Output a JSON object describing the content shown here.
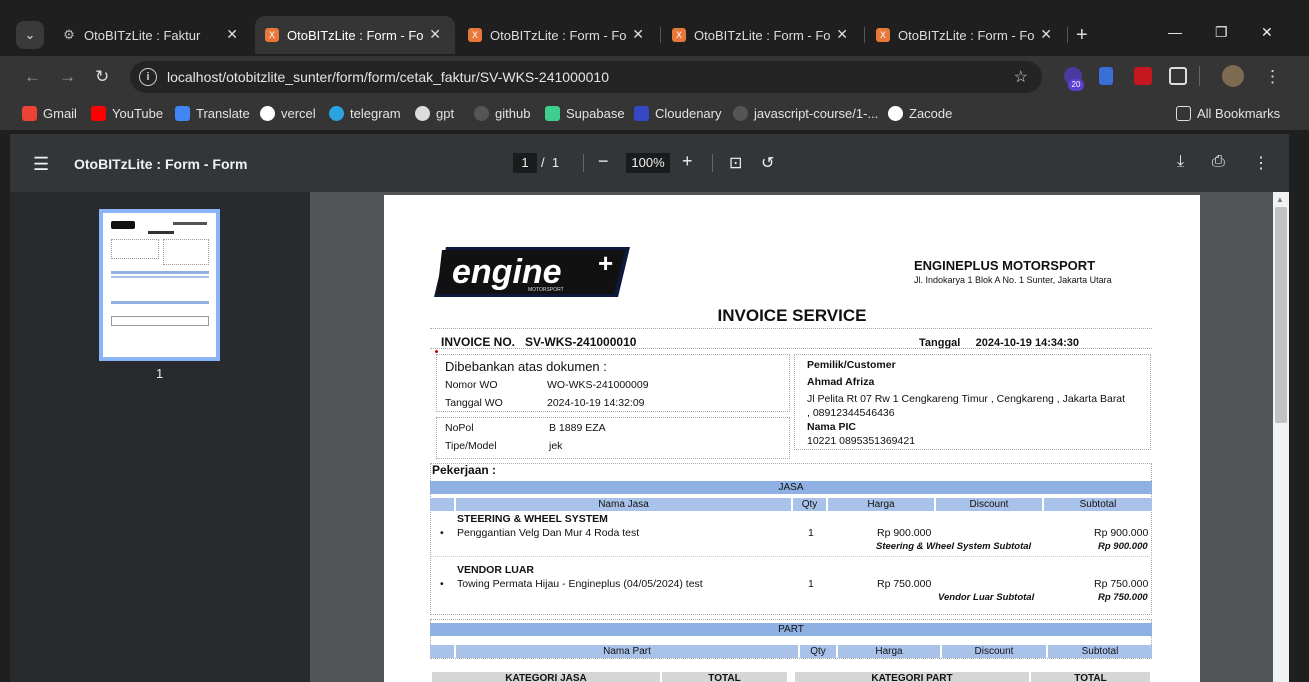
{
  "browser": {
    "tabs": [
      {
        "title": "OtoBITzLite : Faktur",
        "active": false
      },
      {
        "title": "OtoBITzLite : Form - Form",
        "active": true
      },
      {
        "title": "OtoBITzLite : Form - Form",
        "active": false
      },
      {
        "title": "OtoBITzLite : Form - Form",
        "active": false
      },
      {
        "title": "OtoBITzLite : Form - Form",
        "active": false
      }
    ],
    "url": "localhost/otobitzlite_sunter/form/form/cetak_faktur/SV-WKS-241000010",
    "extension_badge": "20",
    "bookmarks": [
      {
        "label": "Gmail"
      },
      {
        "label": "YouTube"
      },
      {
        "label": "Translate"
      },
      {
        "label": "vercel"
      },
      {
        "label": "telegram"
      },
      {
        "label": "gpt"
      },
      {
        "label": "github"
      },
      {
        "label": "Supabase"
      },
      {
        "label": "Cloudenary"
      },
      {
        "label": "javascript-course/1-..."
      },
      {
        "label": "Zacode"
      }
    ],
    "all_bookmarks": "All Bookmarks"
  },
  "viewer": {
    "title": "OtoBITzLite : Form - Form",
    "page_current": "1",
    "page_sep": "/",
    "page_total": "1",
    "zoom": "100%",
    "thumb_label": "1"
  },
  "invoice": {
    "company_name": "ENGINEPLUS MOTORSPORT",
    "company_address": "Jl. Indokarya 1 Blok A No. 1 Sunter, Jakarta Utara",
    "logo_text": "engine",
    "logo_sub": "MOTORSPORT",
    "title": "INVOICE SERVICE",
    "invoice_no_label": "INVOICE NO.",
    "invoice_no": "SV-WKS-241000010",
    "tanggal_label": "Tanggal",
    "tanggal": "2024-10-19 14:34:30",
    "dibebankan_label": "Dibebankan atas dokumen :",
    "nomor_wo_label": "Nomor WO",
    "nomor_wo": "WO-WKS-241000009",
    "tanggal_wo_label": "Tanggal WO",
    "tanggal_wo": "2024-10-19 14:32:09",
    "nopol_label": "NoPol",
    "nopol": "B 1889 EZA",
    "tipe_label": "Tipe/Model",
    "tipe": "jek",
    "customer_label": "Pemilik/Customer",
    "customer_name": "Ahmad Afriza",
    "customer_address": "Jl Pelita Rt 07 Rw 1 Cengkareng Timur , Cengkareng , Jakarta Barat",
    "customer_phone": ", 08912344546436",
    "pic_label": "Nama PIC",
    "pic": "10221 0895351369421",
    "pekerjaan_label": "Pekerjaan :",
    "jasa_label": "JASA",
    "jasa_columns": [
      "Nama Jasa",
      "Qty",
      "Harga",
      "Discount",
      "Subtotal"
    ],
    "jasa_groups": [
      {
        "group": "STEERING & WHEEL SYSTEM",
        "bullet": "•",
        "item": "Penggantian Velg Dan Mur 4 Roda test",
        "qty": "1",
        "harga": "Rp 900.000",
        "subtotal": "Rp 900.000",
        "subtotal_label": "Steering & Wheel System Subtotal",
        "subtotal_value": "Rp 900.000"
      },
      {
        "group": "VENDOR LUAR",
        "bullet": "•",
        "item": "Towing Permata Hijau - Engineplus (04/05/2024) test",
        "qty": "1",
        "harga": "Rp 750.000",
        "subtotal": "Rp 750.000",
        "subtotal_label": "Vendor Luar Subtotal",
        "subtotal_value": "Rp 750.000"
      }
    ],
    "part_label": "PART",
    "part_columns": [
      "Nama Part",
      "Qty",
      "Harga",
      "Discount",
      "Subtotal"
    ],
    "summary_headers": [
      "KATEGORI JASA",
      "TOTAL",
      "KATEGORI PART",
      "TOTAL"
    ]
  },
  "colors": {
    "tab_strip": "#1f1f1f",
    "toolbar": "#353535",
    "viewer_bar": "#323639",
    "viewport": "#525659",
    "table_header": "#8fb0e2"
  }
}
